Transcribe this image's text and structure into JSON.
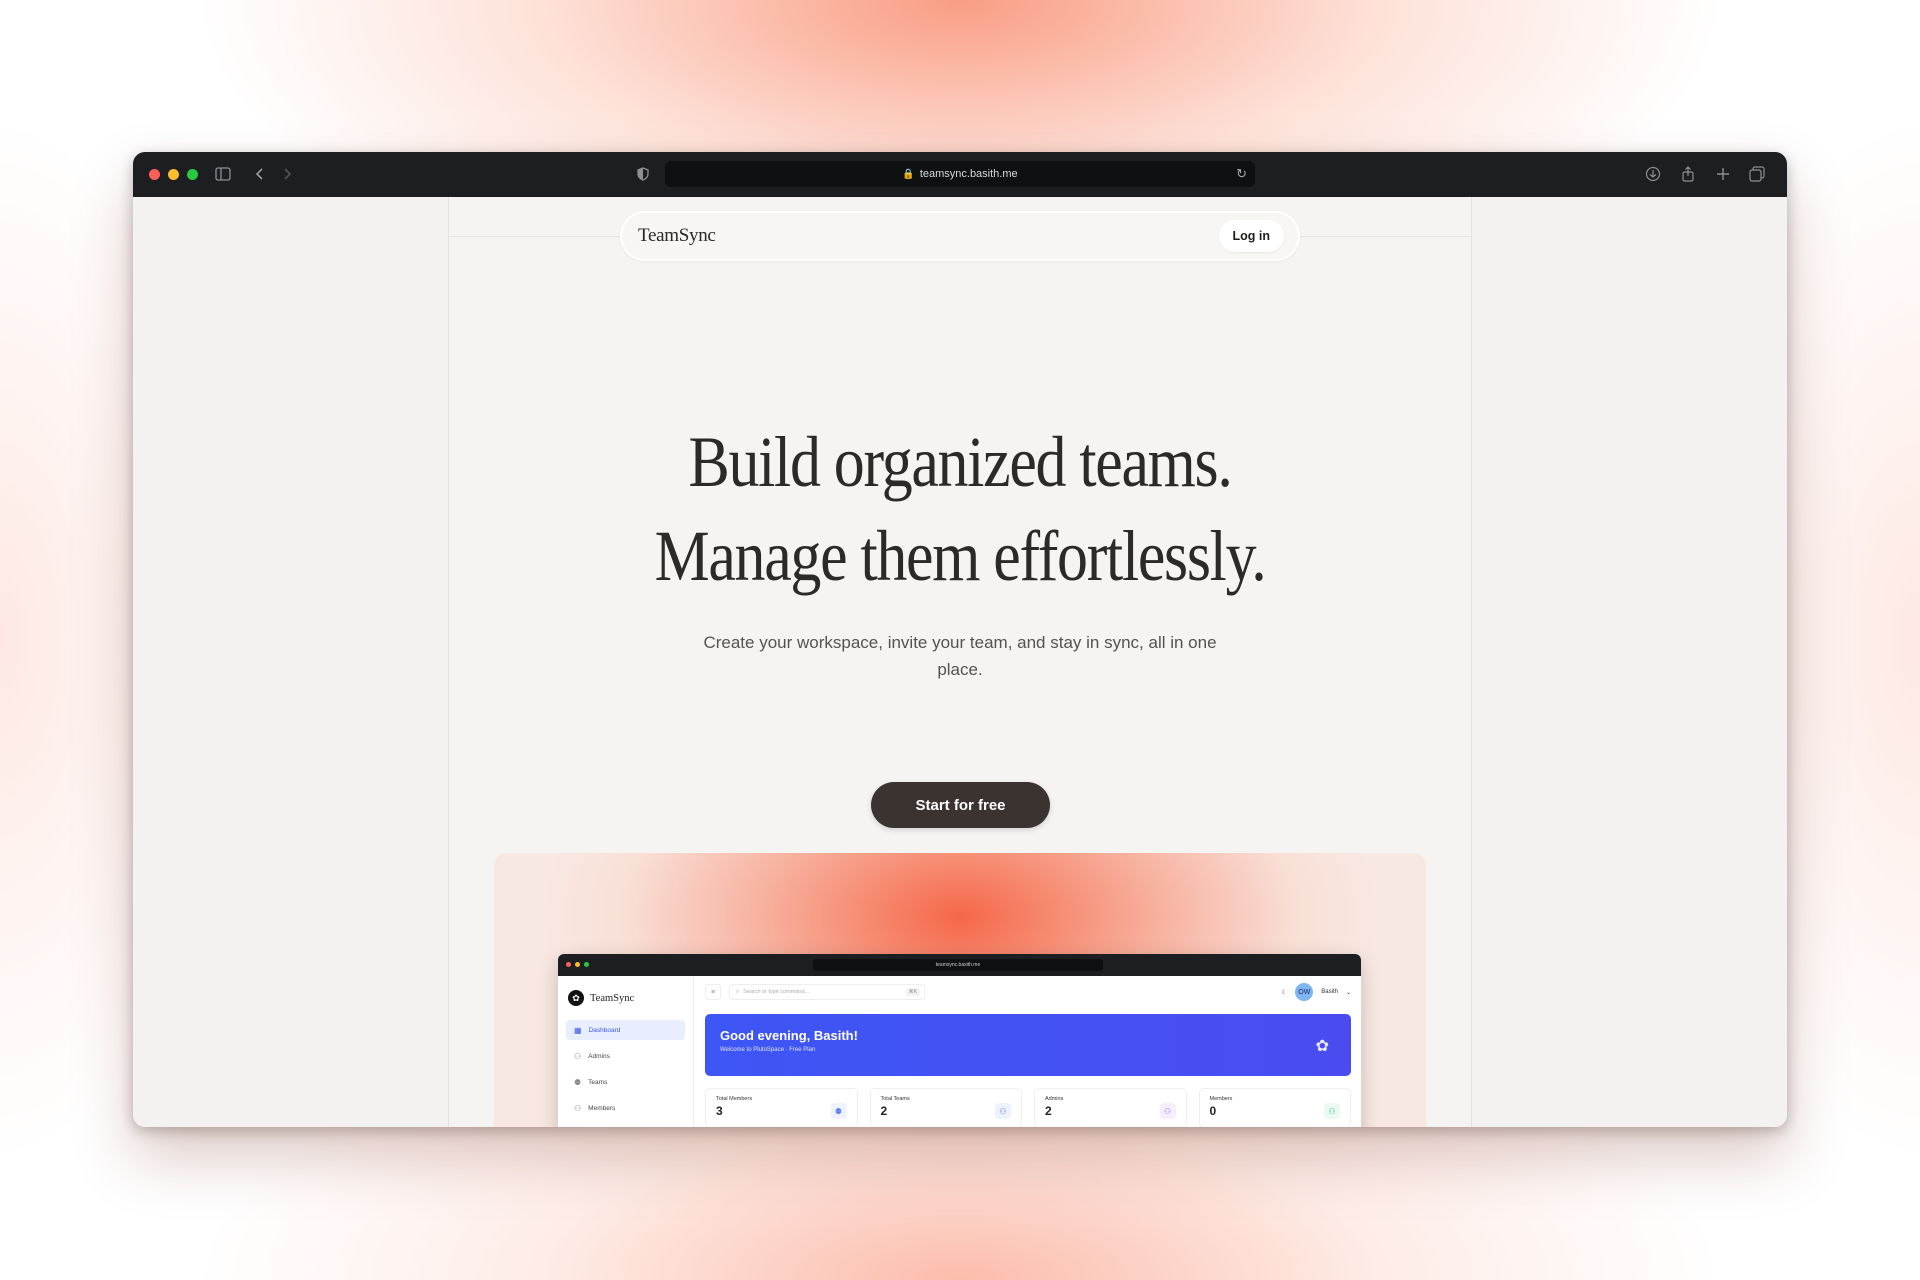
{
  "browser": {
    "url": "teamsync.basith.me"
  },
  "navbar": {
    "brand": "TeamSync",
    "login_label": "Log in"
  },
  "hero": {
    "title_line1": "Build organized teams.",
    "title_line2": "Manage them effortlessly.",
    "subtitle": "Create your workspace, invite your team, and stay in sync, all in one place.",
    "cta_label": "Start for free"
  },
  "preview": {
    "url": "teamsync.basith.me",
    "brand": "TeamSync",
    "search_placeholder": "Search or type command...",
    "search_shortcut": "⌘K",
    "user_initials": "OW",
    "user_name": "Basith",
    "sidebar": [
      {
        "label": "Dashboard",
        "active": true
      },
      {
        "label": "Admins",
        "active": false
      },
      {
        "label": "Teams",
        "active": false
      },
      {
        "label": "Members",
        "active": false
      }
    ],
    "banner_title": "Good evening, Basith!",
    "banner_subtitle": "Welcome to PlutoSpace · Free Plan",
    "cards": [
      {
        "label": "Total Members",
        "value": "3",
        "accent": "#5b7cf5"
      },
      {
        "label": "Total Teams",
        "value": "2",
        "accent": "#4a7cf0"
      },
      {
        "label": "Admins",
        "value": "2",
        "accent": "#a26bf0"
      },
      {
        "label": "Members",
        "value": "0",
        "accent": "#2fbf6e"
      }
    ]
  },
  "colors": {
    "cta_bg": "#3a3330",
    "banner_blue": "#3d56f5",
    "glow": "#f6603f"
  }
}
